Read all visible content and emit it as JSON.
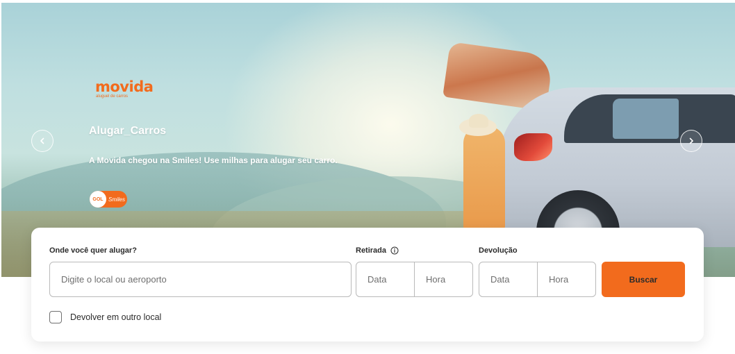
{
  "hero": {
    "brand": {
      "name": "movida",
      "tagline": "aluguel de carros"
    },
    "title": "Alugar_Carros",
    "subtitle": "A Movida chegou na Smiles! Use milhas para alugar seu carro.",
    "partner_badge": {
      "gol": "GOL",
      "smiles": "Smiles"
    },
    "prev_icon": "chevron-left-icon",
    "next_icon": "chevron-right-icon"
  },
  "search": {
    "location_label": "Onde você quer alugar?",
    "location_placeholder": "Digite o local ou aeroporto",
    "pickup_label": "Retirada",
    "pickup_info_icon": "info-icon",
    "pickup_date_placeholder": "Data",
    "pickup_time_placeholder": "Hora",
    "return_label": "Devolução",
    "return_date_placeholder": "Data",
    "return_time_placeholder": "Hora",
    "submit_label": "Buscar",
    "other_location_label": "Devolver em outro local"
  },
  "colors": {
    "brand_orange": "#f26b1d",
    "card_background": "#ffffff",
    "input_border": "#b9b9b9",
    "text_dark": "#2b2b2b",
    "text_muted": "#6f6f6f"
  }
}
